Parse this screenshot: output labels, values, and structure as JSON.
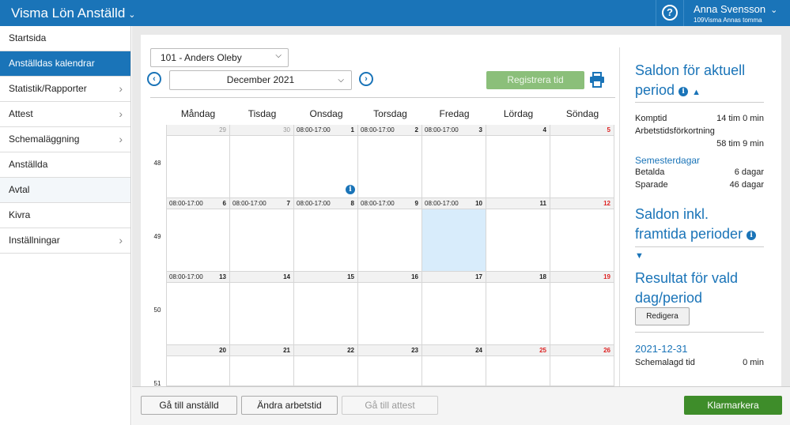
{
  "header": {
    "app_title": "Visma Lön Anställd",
    "help_label": "?",
    "user_name": "Anna Svensson",
    "org": "109Visma Annas tomma"
  },
  "sidebar": {
    "items": [
      {
        "label": "Startsida",
        "arrow": false
      },
      {
        "label": "Anställdas kalendrar",
        "arrow": false
      },
      {
        "label": "Statistik/Rapporter",
        "arrow": true
      },
      {
        "label": "Attest",
        "arrow": true
      },
      {
        "label": "Schemaläggning",
        "arrow": true
      },
      {
        "label": "Anställda",
        "arrow": false
      },
      {
        "label": "Avtal",
        "arrow": false
      },
      {
        "label": "Kivra",
        "arrow": false
      },
      {
        "label": "Inställningar",
        "arrow": true
      }
    ]
  },
  "toolbar": {
    "employee": "101 - Anders Oleby",
    "month": "December 2021",
    "register": "Registrera tid"
  },
  "calendar": {
    "weekdays": [
      "Måndag",
      "Tisdag",
      "Onsdag",
      "Torsdag",
      "Fredag",
      "Lördag",
      "Söndag"
    ],
    "weeks": [
      {
        "number": "48",
        "days": [
          {
            "n": "29",
            "t": "",
            "c": "g"
          },
          {
            "n": "30",
            "t": "",
            "c": "g"
          },
          {
            "n": "1",
            "t": "08:00-17:00",
            "c": ""
          },
          {
            "n": "2",
            "t": "08:00-17:00",
            "c": ""
          },
          {
            "n": "3",
            "t": "08:00-17:00",
            "c": ""
          },
          {
            "n": "4",
            "t": "",
            "c": ""
          },
          {
            "n": "5",
            "t": "",
            "c": "r"
          }
        ]
      },
      {
        "number": "49",
        "days": [
          {
            "n": "6",
            "t": "08:00-17:00",
            "c": ""
          },
          {
            "n": "7",
            "t": "08:00-17:00",
            "c": ""
          },
          {
            "n": "8",
            "t": "08:00-17:00",
            "c": ""
          },
          {
            "n": "9",
            "t": "08:00-17:00",
            "c": ""
          },
          {
            "n": "10",
            "t": "08:00-17:00",
            "c": ""
          },
          {
            "n": "11",
            "t": "",
            "c": ""
          },
          {
            "n": "12",
            "t": "",
            "c": "r"
          }
        ]
      },
      {
        "number": "50",
        "days": [
          {
            "n": "13",
            "t": "08:00-17:00",
            "c": ""
          },
          {
            "n": "14",
            "t": "",
            "c": ""
          },
          {
            "n": "15",
            "t": "",
            "c": ""
          },
          {
            "n": "16",
            "t": "",
            "c": ""
          },
          {
            "n": "17",
            "t": "",
            "c": ""
          },
          {
            "n": "18",
            "t": "",
            "c": ""
          },
          {
            "n": "19",
            "t": "",
            "c": "r"
          }
        ]
      },
      {
        "number": "51",
        "days": [
          {
            "n": "20",
            "t": "",
            "c": ""
          },
          {
            "n": "21",
            "t": "",
            "c": ""
          },
          {
            "n": "22",
            "t": "",
            "c": ""
          },
          {
            "n": "23",
            "t": "",
            "c": ""
          },
          {
            "n": "24",
            "t": "",
            "c": ""
          },
          {
            "n": "25",
            "t": "",
            "c": "r"
          },
          {
            "n": "26",
            "t": "",
            "c": "r"
          }
        ]
      }
    ]
  },
  "right": {
    "balance_title": "Saldon för aktuell period",
    "komptid_label": "Komptid",
    "komptid_value": "14 tim 0 min",
    "atf_label": "Arbetstidsförkortning",
    "atf_value": "58 tim 9 min",
    "vac_title": "Semesterdagar",
    "paid_label": "Betalda",
    "paid_value": "6 dagar",
    "saved_label": "Sparade",
    "saved_value": "46 dagar",
    "future_title": "Saldon inkl. framtida perioder",
    "result_title": "Resultat för vald dag/period",
    "edit_label": "Redigera",
    "date": "2021-12-31",
    "sched_label": "Schemalagd tid",
    "sched_value": "0 min"
  },
  "footer": {
    "goto_employee": "Gå till anställd",
    "change_worktime": "Ändra arbetstid",
    "goto_attest": "Gå till attest",
    "klar": "Klarmarkera"
  }
}
